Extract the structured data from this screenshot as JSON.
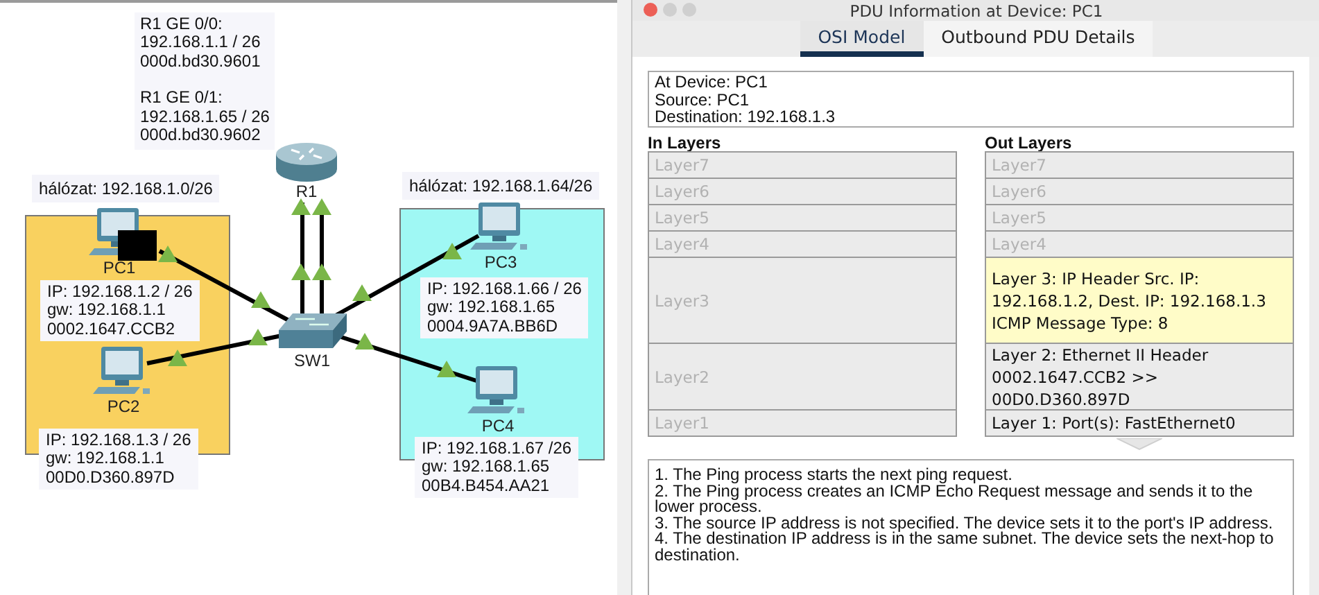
{
  "canvas": {
    "router_note": [
      [
        "R1 GE 0/0:",
        "192.168.1.1 / 26",
        "000d.bd30.9601"
      ],
      [
        "R1 GE 0/1:",
        "192.168.1.65 / 26",
        "000d.bd30.9602"
      ]
    ],
    "areas": [
      {
        "label": "hálózat: 192.168.1.0/26",
        "color": "#f9d15f"
      },
      {
        "label": "hálózat: 192.168.1.64/26",
        "color": "#9ff8f4"
      }
    ],
    "devices": [
      {
        "kind": "router",
        "name": "R1"
      },
      {
        "kind": "switch",
        "name": "SW1"
      },
      {
        "kind": "pc",
        "name": "PC1",
        "has_pdu": true,
        "info": [
          "IP: 192.168.1.2 / 26",
          "gw: 192.168.1.1",
          "0002.1647.CCB2"
        ]
      },
      {
        "kind": "pc",
        "name": "PC2",
        "has_pdu": false,
        "info": [
          "IP: 192.168.1.3 / 26",
          "gw: 192.168.1.1",
          "00D0.D360.897D"
        ]
      },
      {
        "kind": "pc",
        "name": "PC3",
        "has_pdu": false,
        "info": [
          "IP: 192.168.1.66 / 26",
          "gw: 192.168.1.65",
          "0004.9A7A.BB6D"
        ]
      },
      {
        "kind": "pc",
        "name": "PC4",
        "has_pdu": false,
        "info": [
          "IP: 192.168.1.67 /26",
          "gw: 192.168.1.65",
          "00B4.B454.AA21"
        ]
      }
    ]
  },
  "window": {
    "title": "PDU Information at Device: PC1",
    "tabs": [
      {
        "label": "OSI Model",
        "selected": true
      },
      {
        "label": "Outbound PDU Details",
        "selected": false
      }
    ],
    "summary": [
      "At Device: PC1",
      "Source: PC1",
      "Destination: 192.168.1.3"
    ],
    "in_layers": {
      "heading": "In Layers",
      "layers": [
        {
          "lines": [
            "Layer7"
          ],
          "active": false,
          "selected": false
        },
        {
          "lines": [
            "Layer6"
          ],
          "active": false,
          "selected": false
        },
        {
          "lines": [
            "Layer5"
          ],
          "active": false,
          "selected": false
        },
        {
          "lines": [
            "Layer4"
          ],
          "active": false,
          "selected": false
        },
        {
          "lines": [
            "Layer3"
          ],
          "active": false,
          "selected": false
        },
        {
          "lines": [
            "Layer2"
          ],
          "active": false,
          "selected": false
        },
        {
          "lines": [
            "Layer1"
          ],
          "active": false,
          "selected": false
        }
      ]
    },
    "out_layers": {
      "heading": "Out Layers",
      "layers": [
        {
          "lines": [
            "Layer7"
          ],
          "active": false,
          "selected": false
        },
        {
          "lines": [
            "Layer6"
          ],
          "active": false,
          "selected": false
        },
        {
          "lines": [
            "Layer5"
          ],
          "active": false,
          "selected": false
        },
        {
          "lines": [
            "Layer4"
          ],
          "active": false,
          "selected": false
        },
        {
          "lines": [
            "Layer 3: IP Header Src. IP:",
            "192.168.1.2, Dest. IP: 192.168.1.3",
            "ICMP Message Type: 8"
          ],
          "active": true,
          "selected": true
        },
        {
          "lines": [
            "Layer 2: Ethernet II Header",
            "0002.1647.CCB2 >>",
            "00D0.D360.897D"
          ],
          "active": true,
          "selected": false
        },
        {
          "lines": [
            "Layer 1: Port(s): FastEthernet0"
          ],
          "active": true,
          "selected": false
        }
      ]
    },
    "steps": [
      "1. The Ping process starts the next ping request.",
      "2. The Ping process creates an ICMP Echo Request message and sends it to the lower process.",
      "3. The source IP address is not specified. The device sets it to the port's IP address.",
      "4. The destination IP address is in the same subnet. The device sets the next-hop to destination."
    ]
  }
}
